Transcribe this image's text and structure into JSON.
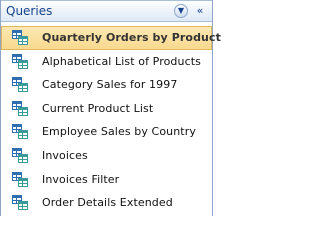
{
  "pane": {
    "title": "Queries",
    "menu_button_glyph": "▼",
    "collapse_button_glyph": "«"
  },
  "items": [
    {
      "label": "Quarterly Orders by Product",
      "icon": "query-icon",
      "selected": true
    },
    {
      "label": "Alphabetical List of Products",
      "icon": "query-icon",
      "selected": false
    },
    {
      "label": "Category Sales for 1997",
      "icon": "query-icon",
      "selected": false
    },
    {
      "label": "Current Product List",
      "icon": "query-icon",
      "selected": false
    },
    {
      "label": "Employee Sales by Country",
      "icon": "query-icon",
      "selected": false
    },
    {
      "label": "Invoices",
      "icon": "query-icon",
      "selected": false
    },
    {
      "label": "Invoices Filter",
      "icon": "query-icon",
      "selected": false
    },
    {
      "label": "Order Details Extended",
      "icon": "query-icon",
      "selected": false
    }
  ],
  "colors": {
    "header_text": "#15428b",
    "selected_bg": "#f8d98d",
    "icon_blue": "#2f6db3",
    "icon_teal": "#3a9a9a"
  }
}
